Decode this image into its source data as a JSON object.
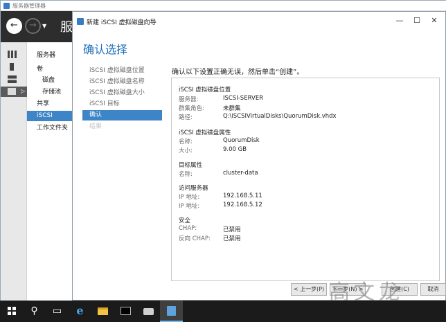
{
  "server_manager": {
    "window_title": "服务器管理器",
    "header_title": "服",
    "nav_items": [
      {
        "label": "服务器"
      },
      {
        "label": "卷"
      },
      {
        "label": "磁盘"
      },
      {
        "label": "存储池"
      },
      {
        "label": "共享"
      },
      {
        "label": "iSCSI"
      },
      {
        "label": "工作文件夹"
      }
    ]
  },
  "wizard": {
    "title": "新建 iSCSI 虚拟磁盘向导",
    "heading": "确认选择",
    "steps": [
      {
        "label": "iSCSI 虚拟磁盘位置"
      },
      {
        "label": "iSCSI 虚拟磁盘名称"
      },
      {
        "label": "iSCSI 虚拟磁盘大小"
      },
      {
        "label": "iSCSI 目标"
      },
      {
        "label": "确认"
      },
      {
        "label": "结果"
      }
    ],
    "instruction": "确认以下设置正确无误，然后单击“创建”。",
    "summary": {
      "location": {
        "title": "iSCSI 虚拟磁盘位置",
        "server_key": "服务器:",
        "server_val": "ISCSI-SERVER",
        "cluster_key": "群集角色:",
        "cluster_val": "未群集",
        "path_key": "路径:",
        "path_val": "Q:\\iSCSIVirtualDisks\\QuorumDisk.vhdx"
      },
      "properties": {
        "title": "iSCSI 虚拟磁盘属性",
        "name_key": "名称:",
        "name_val": "QuorumDisk",
        "size_key": "大小:",
        "size_val": "9.00 GB"
      },
      "target": {
        "title": "目标属性",
        "name_key": "名称:",
        "name_val": "cluster-data"
      },
      "access": {
        "title": "访问服务器",
        "ip1_key": "IP 地址:",
        "ip1_val": "192.168.5.11",
        "ip2_key": "IP 地址:",
        "ip2_val": "192.168.5.12"
      },
      "security": {
        "title": "安全",
        "chap_key": "CHAP:",
        "chap_val": "已禁用",
        "rchap_key": "反向 CHAP:",
        "rchap_val": "已禁用"
      }
    },
    "buttons": {
      "prev": "< 上一步(P)",
      "next": "下一步(N) >",
      "create": "创建(C)",
      "cancel": "取消"
    }
  },
  "watermark": "高文龙",
  "taskbar": {
    "icons": [
      "windows-start-icon",
      "search-icon",
      "task-view-icon",
      "internet-explorer-icon",
      "file-explorer-icon",
      "command-prompt-icon",
      "server-tools-icon",
      "server-manager-icon"
    ]
  }
}
